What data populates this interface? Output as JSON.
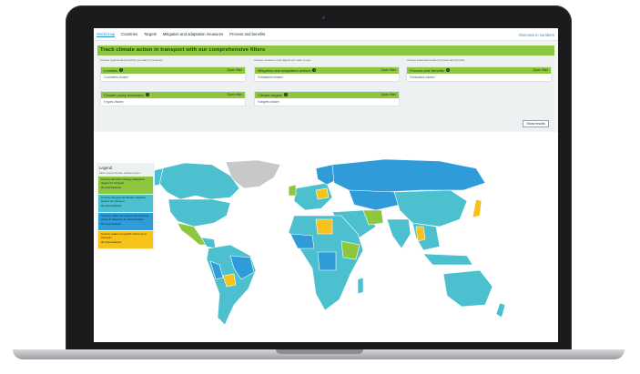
{
  "nav": {
    "tabs": [
      {
        "label": "World map"
      },
      {
        "label": "Countries"
      },
      {
        "label": "Targets"
      },
      {
        "label": "Mitigation and adaptation measures"
      },
      {
        "label": "Process and benefits"
      }
    ],
    "right_link": "Overview in numbers"
  },
  "banner": {
    "title": "Track climate action in transport with our comprehensive filters"
  },
  "filters": {
    "hints": [
      "Choose regions and countries you want to compare",
      "Choose measures and targets you want to see",
      "Choose parameters about process and benefits"
    ],
    "boxes": [
      {
        "title": "Location",
        "open": "Open filter",
        "value": "0 countries chosen"
      },
      {
        "title": "Mitigation and adaptation actions",
        "open": "Open filter",
        "value": "0 measures chosen"
      },
      {
        "title": "Process and Benefits",
        "open": "Open filter",
        "value": "0 indicators chosen"
      },
      {
        "title": "Climate policy document",
        "open": "Open filter",
        "value": "0 types chosen"
      },
      {
        "title": "Climate targets",
        "open": "Open filter",
        "value": "0 targets chosen"
      }
    ],
    "show_results": "Show results"
  },
  "legend": {
    "title": "Legend",
    "subtitle": "Most recent climate policies types",
    "items": [
      {
        "text": "Country has NDC strategy adaptation targets for transport",
        "count": "00 countries/land",
        "color": "#8dc63f"
      },
      {
        "text": "Country has general climate mitigation actions for transport",
        "count": "00 countries/land",
        "color": "#4cc0cf"
      },
      {
        "text": "Country's NDC has targets and reporting action & measures for transportation",
        "count": "00 countries/land",
        "color": "#2f9bd8"
      },
      {
        "text": "Country makes no specific reference to transport",
        "count": "00 countries/land",
        "color": "#f7c21a"
      }
    ]
  },
  "colors": {
    "green": "#8dc63f",
    "teal": "#4cc0cf",
    "blue": "#2f9bd8",
    "yellow": "#f7c21a",
    "nodata": "#c6c8c9"
  }
}
